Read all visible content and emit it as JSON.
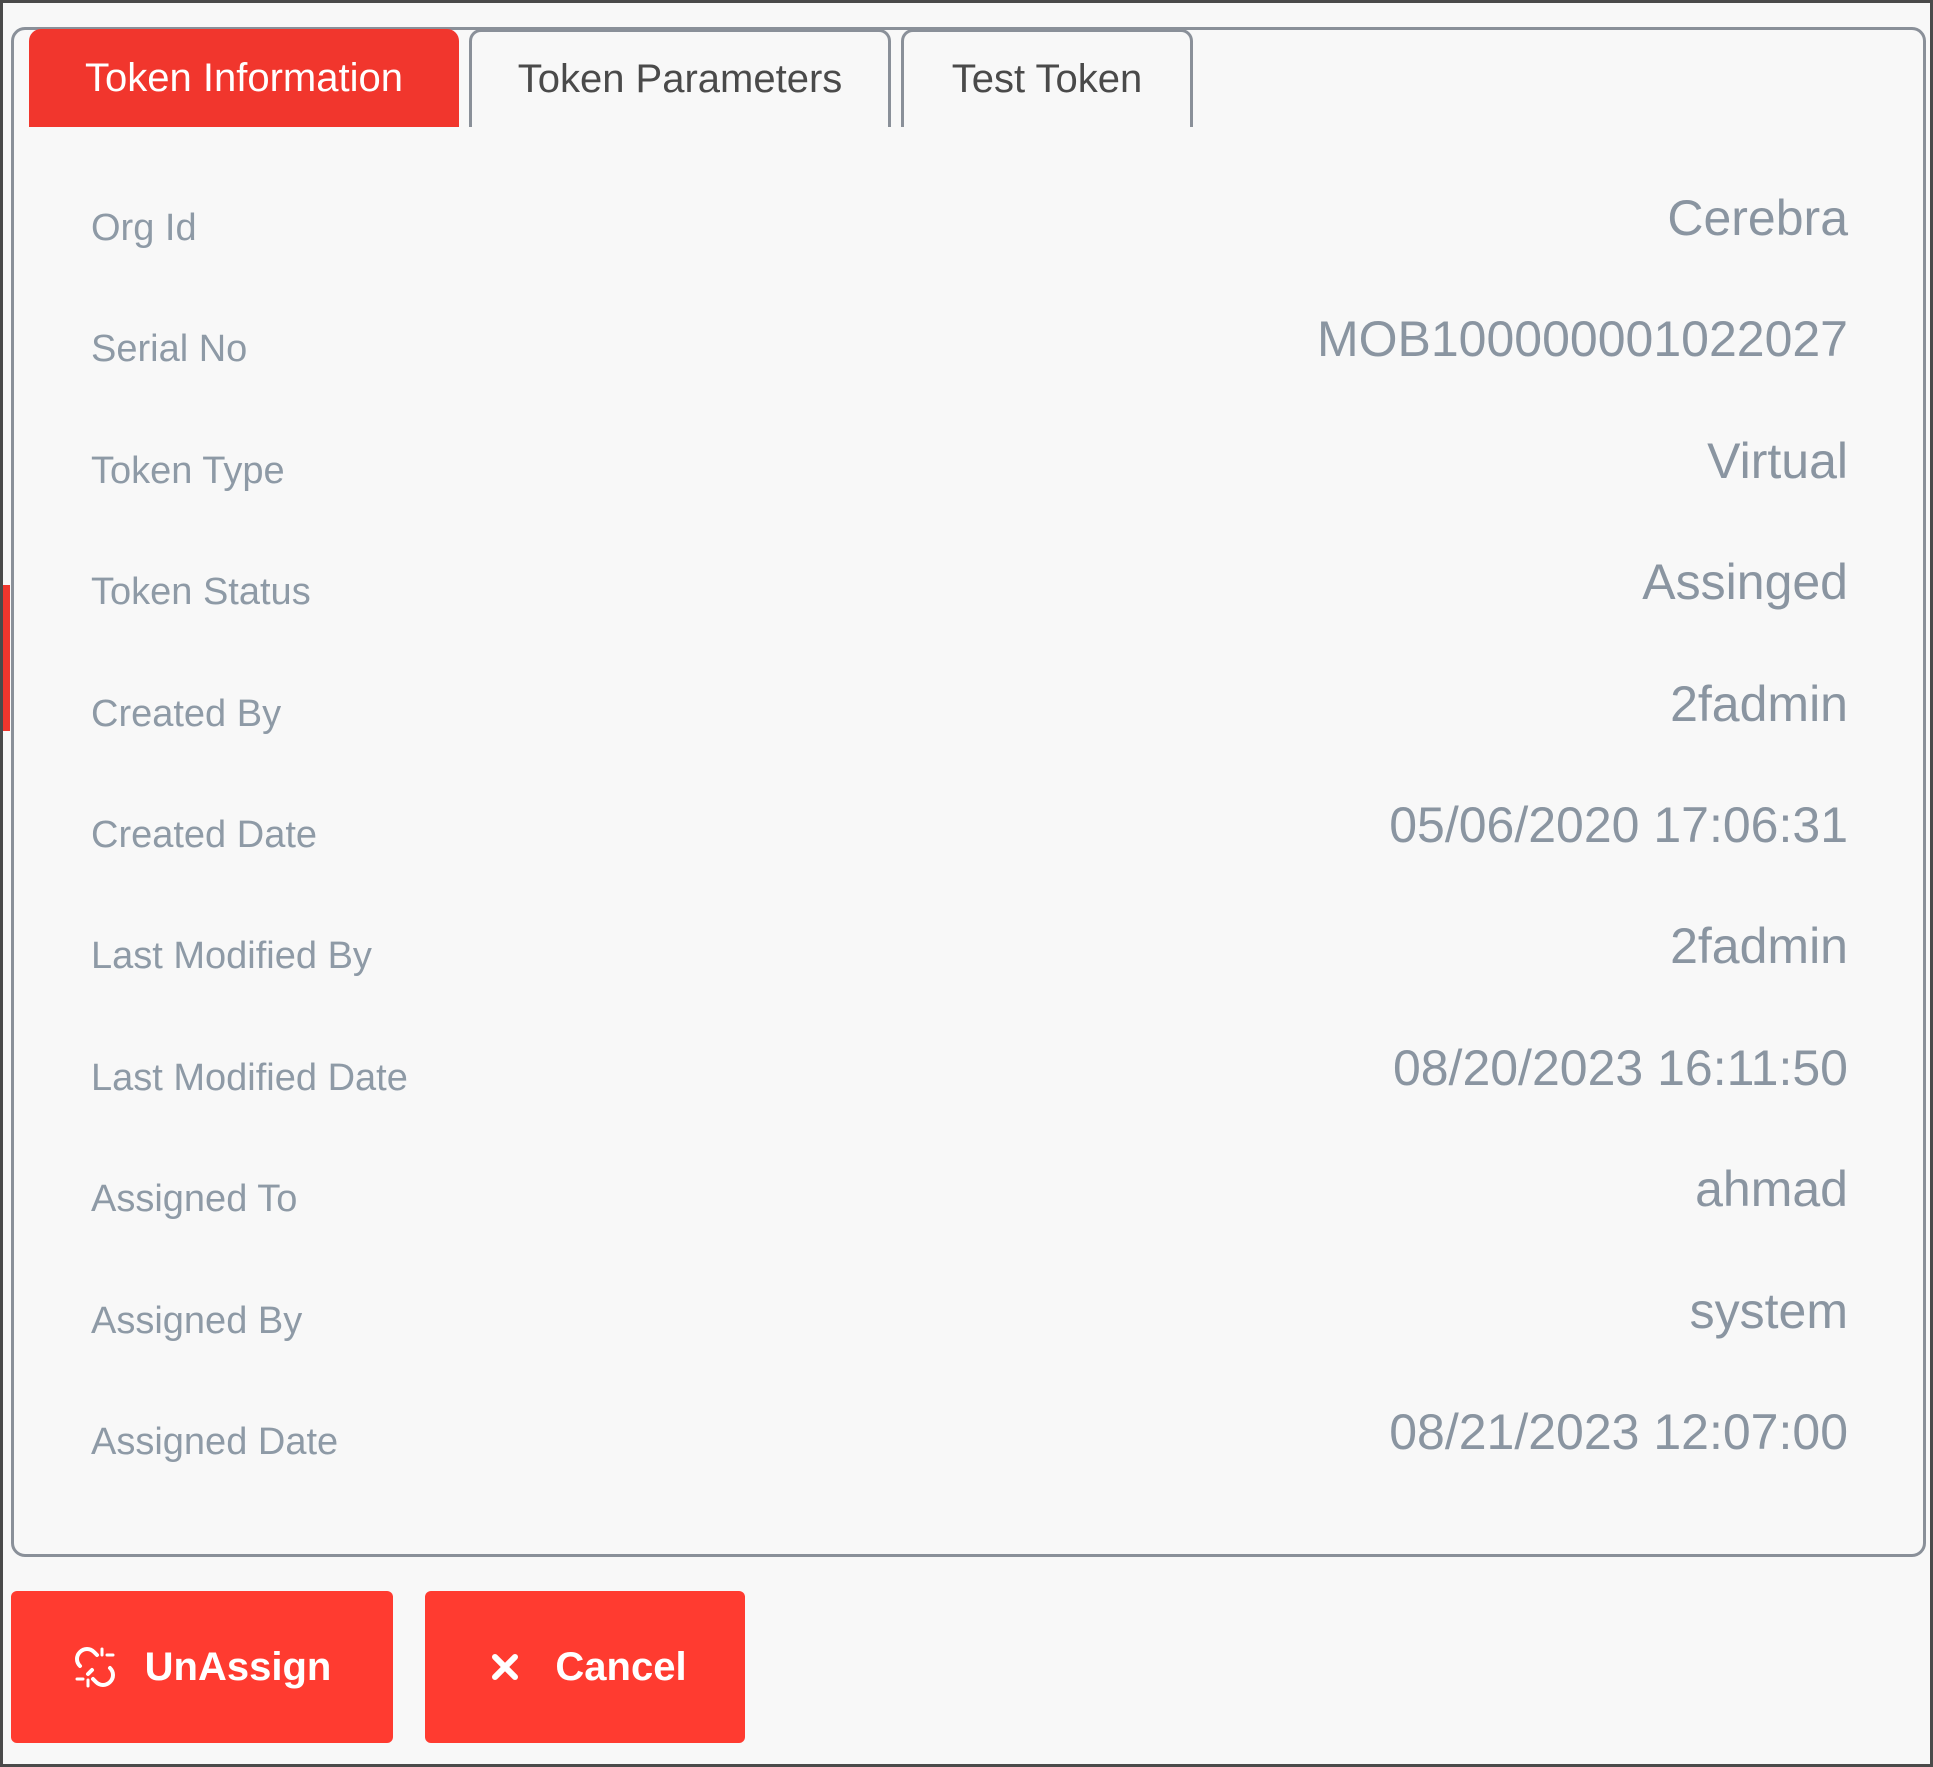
{
  "tabs": [
    {
      "label": "Token Information",
      "active": true
    },
    {
      "label": "Token Parameters",
      "active": false
    },
    {
      "label": "Test Token",
      "active": false
    }
  ],
  "fields": [
    {
      "label": "Org Id",
      "value": "Cerebra"
    },
    {
      "label": "Serial No",
      "value": "MOB100000001022027"
    },
    {
      "label": "Token Type",
      "value": "Virtual"
    },
    {
      "label": "Token Status",
      "value": "Assinged"
    },
    {
      "label": "Created By",
      "value": "2fadmin"
    },
    {
      "label": "Created Date",
      "value": "05/06/2020 17:06:31"
    },
    {
      "label": "Last Modified By",
      "value": "2fadmin"
    },
    {
      "label": "Last Modified Date",
      "value": "08/20/2023 16:11:50"
    },
    {
      "label": "Assigned To",
      "value": "ahmad"
    },
    {
      "label": "Assigned By",
      "value": "system"
    },
    {
      "label": "Assigned Date",
      "value": "08/21/2023 12:07:00"
    }
  ],
  "actions": {
    "unassign": {
      "label": "UnAssign",
      "icon": "unlink-icon"
    },
    "cancel": {
      "label": "Cancel",
      "icon": "close-icon"
    }
  },
  "colors": {
    "accent": "#f1362d",
    "button": "#ff3b30",
    "label_text": "#8e9aa6",
    "value_text": "#8a95a1",
    "border": "#8a9099"
  }
}
